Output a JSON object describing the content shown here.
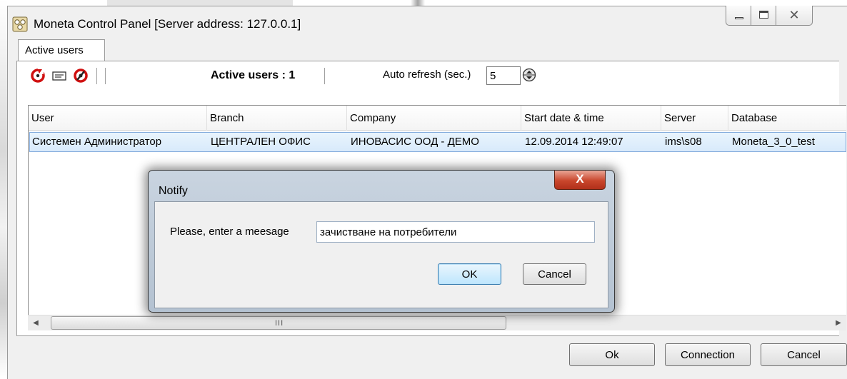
{
  "window": {
    "title": "Moneta Control Panel [Server address: 127.0.0.1]",
    "close_glyph": "✕"
  },
  "tabs": [
    {
      "label": "Active users"
    }
  ],
  "toolbar": {
    "icons": [
      "refresh-icon",
      "message-icon",
      "disconnect-icon"
    ],
    "active_users_label": "Active users : 1",
    "auto_refresh_label": "Auto refresh (sec.)",
    "auto_refresh_value": "5"
  },
  "grid": {
    "columns": [
      "User",
      "Branch",
      "Company",
      "Start date & time",
      "Server",
      "Database"
    ],
    "rows": [
      {
        "user": "Системен Администратор",
        "branch": "ЦЕНТРАЛЕН ОФИС",
        "company": "ИНОВАСИС ООД - ДЕМО",
        "start": "12.09.2014 12:49:07",
        "server": "ims\\s08",
        "database": "Moneta_3_0_test"
      }
    ],
    "scroll_left": "◀",
    "scroll_right": "▶",
    "scroll_grip": "III"
  },
  "footer": {
    "ok_label": "Ok",
    "connection_label": "Connection",
    "cancel_label": "Cancel"
  },
  "dialog": {
    "title": "Notify",
    "close_glyph": "X",
    "prompt": "Please, enter a meesage",
    "message_value": "зачистване на потребители",
    "ok_label": "OK",
    "cancel_label": "Cancel"
  },
  "colors": {
    "selection": "#d8eafb",
    "close_red": "#c9462c",
    "toolbar_icon_red": "#d01010"
  }
}
